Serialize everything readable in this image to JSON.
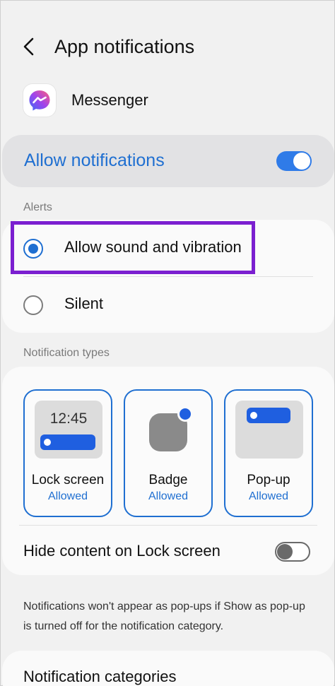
{
  "header": {
    "title": "App notifications",
    "back_icon": "back-arrow-icon"
  },
  "app": {
    "name": "Messenger",
    "icon": "messenger-icon"
  },
  "allow_notifications": {
    "label": "Allow notifications",
    "enabled": true
  },
  "alerts": {
    "section_label": "Alerts",
    "options": [
      {
        "label": "Allow sound and vibration",
        "selected": true
      },
      {
        "label": "Silent",
        "selected": false
      }
    ]
  },
  "notification_types": {
    "section_label": "Notification types",
    "tiles": [
      {
        "name": "Lock screen",
        "status": "Allowed",
        "preview_time": "12:45"
      },
      {
        "name": "Badge",
        "status": "Allowed"
      },
      {
        "name": "Pop-up",
        "status": "Allowed"
      }
    ],
    "hide_content": {
      "label": "Hide content on Lock screen",
      "enabled": false
    }
  },
  "info_text": "Notifications won't appear as pop-ups if Show as pop-up is turned off for the notification category.",
  "categories": {
    "label": "Notification categories"
  },
  "colors": {
    "accent": "#1f6fd1",
    "toggle_on": "#2f7be8",
    "highlight": "#7b1fd0"
  }
}
